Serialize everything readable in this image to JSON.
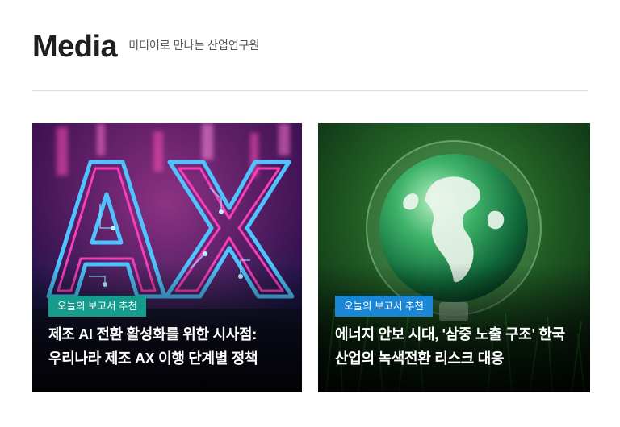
{
  "header": {
    "title": "Media",
    "subtitle": "미디어로 만나는 산업연구원"
  },
  "cards": [
    {
      "badge": "오늘의 보고서 추천",
      "badge_color": "#159c8c",
      "title_line1": "제조 AI 전환 활성화를 위한 시사점:",
      "title_line2": "우리나라 제조 AX 이행 단계별 정책",
      "image_text": "AX"
    },
    {
      "badge": "오늘의 보고서 추천",
      "badge_color": "#1a86d6",
      "title_line1": "에너지 안보 시대, '삼중 노출 구조' 한국",
      "title_line2": "산업의 녹색전환 리스크 대응"
    }
  ]
}
